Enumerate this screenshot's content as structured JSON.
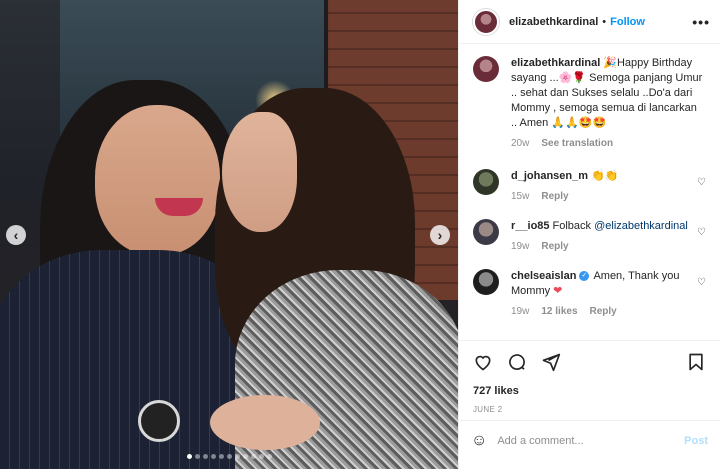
{
  "post": {
    "username": "elizabethkardinal",
    "follow_label": "Follow",
    "more_label": "•••",
    "separator": "•",
    "carousel_dots": 11,
    "active_dot": 0
  },
  "caption": {
    "username": "elizabethkardinal",
    "text": "🎉Happy Birthday sayang ...🌸🌹 Semoga panjang Umur .. sehat dan Sukses selalu ..Do'a dari Mommy , semoga semua di lancarkan .. Amen 🙏🙏🤩🤩",
    "time": "20w",
    "see_translation": "See translation"
  },
  "comments": [
    {
      "username": "d_johansen_m",
      "text": "👏👏",
      "time": "15w",
      "reply": "Reply"
    },
    {
      "username": "r__io85",
      "text": "Folback ",
      "mention": "@elizabethkardinal",
      "time": "19w",
      "reply": "Reply"
    },
    {
      "username": "chelseaislan",
      "verified": true,
      "text": "Amen, Thank you Mommy ",
      "heart": "❤",
      "time": "19w",
      "likes": "12 likes",
      "reply": "Reply"
    }
  ],
  "actions": {
    "likes": "727 likes",
    "date": "JUNE 2"
  },
  "add_comment": {
    "placeholder": "Add a comment...",
    "post_label": "Post"
  },
  "icons": [
    "heart-icon",
    "comment-icon",
    "share-icon",
    "bookmark-icon",
    "smile-icon",
    "chevron-left-icon",
    "chevron-right-icon",
    "verified-icon"
  ]
}
